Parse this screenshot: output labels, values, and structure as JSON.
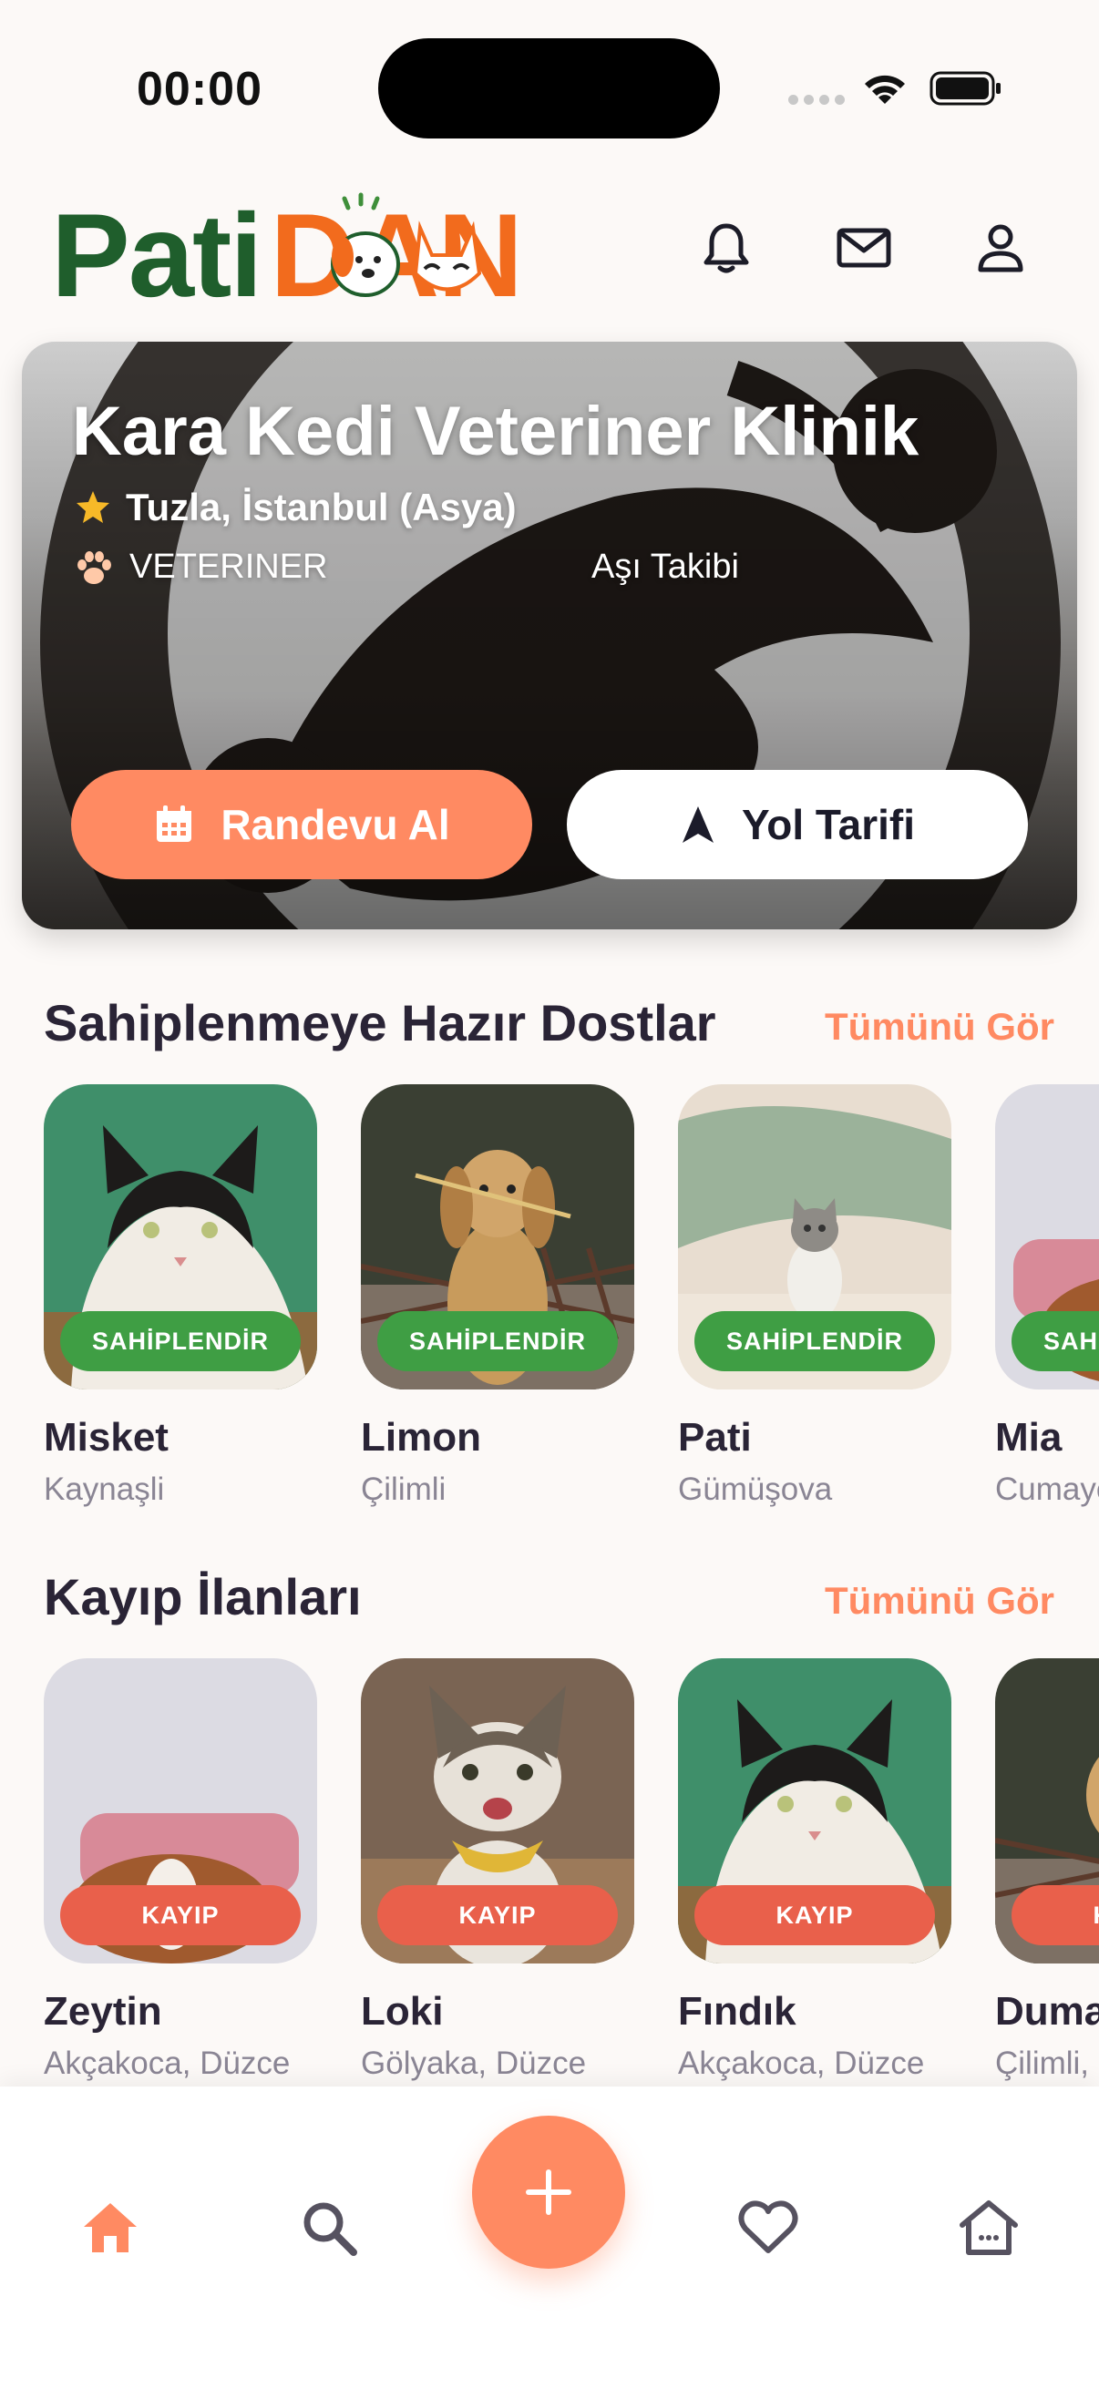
{
  "status_bar": {
    "time": "00:00"
  },
  "header": {
    "logo_part1": "Pati",
    "logo_part2": "DAN"
  },
  "featured": {
    "title": "Kara Kedi Veteriner Klinik",
    "location": "Tuzla, İstanbul (Asya)",
    "category": "VETERINER",
    "service": "Aşı Takibi",
    "primary_button": "Randevu Al",
    "secondary_button": "Yol Tarifi"
  },
  "adoption": {
    "title": "Sahiplenmeye Hazır Dostlar",
    "see_all": "Tümünü Gör",
    "items": [
      {
        "name": "Misket",
        "location": "Kaynaşli",
        "badge": "SAHİPLENDİR"
      },
      {
        "name": "Limon",
        "location": "Çilimli",
        "badge": "SAHİPLENDİR"
      },
      {
        "name": "Pati",
        "location": "Gümüşova",
        "badge": "SAHİPLENDİR"
      },
      {
        "name": "Mia",
        "location": "Cumayeri",
        "badge": "SAHİPLENDİR"
      }
    ]
  },
  "lost": {
    "title": "Kayıp İlanları",
    "see_all": "Tümünü Gör",
    "items": [
      {
        "name": "Zeytin",
        "location": "Akçakoca, Düzce",
        "badge": "KAYIP"
      },
      {
        "name": "Loki",
        "location": "Gölyaka, Düzce",
        "badge": "KAYIP"
      },
      {
        "name": "Fındık",
        "location": "Akçakoca, Düzce",
        "badge": "KAYIP"
      },
      {
        "name": "Duman",
        "location": "Çilimli, Düzce",
        "badge": "KAYIP"
      }
    ]
  },
  "colors": {
    "accent": "#ff8a62",
    "brand_green": "#1f5e2c",
    "brand_orange": "#f26b1d",
    "adopt_badge": "#3f9e44",
    "lost_badge": "#e9604b"
  },
  "tabbar": {
    "icons": [
      "home-icon",
      "search-icon",
      "plus-icon",
      "heart-icon",
      "shelter-icon"
    ],
    "active": "home-icon"
  }
}
